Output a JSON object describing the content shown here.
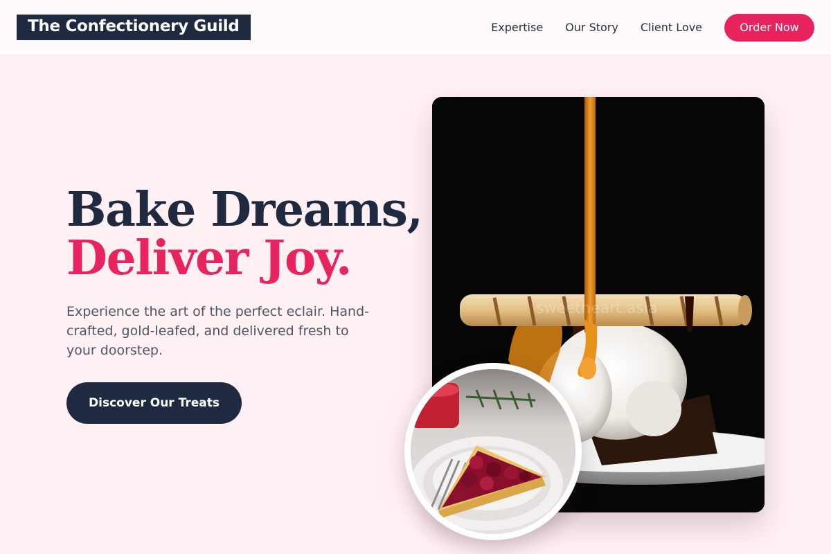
{
  "header": {
    "brand": "The Confectionery Guild",
    "nav": [
      "Expertise",
      "Our Story",
      "Client Love"
    ],
    "cta_label": "Order Now"
  },
  "hero": {
    "headline_line1": "Bake Dreams,",
    "headline_line2": "Deliver Joy.",
    "subtext": "Experience the art of the perfect eclair. Hand-crafted, gold-leafed, and delivered fresh to your doorstep.",
    "cta_label": "Discover Our Treats"
  },
  "images": {
    "main_watermark": "sweetheart.asia"
  },
  "colors": {
    "accent": "#e8245f",
    "navy": "#1f2a40",
    "background": "#fff0f4",
    "text_muted": "#4e5565"
  }
}
